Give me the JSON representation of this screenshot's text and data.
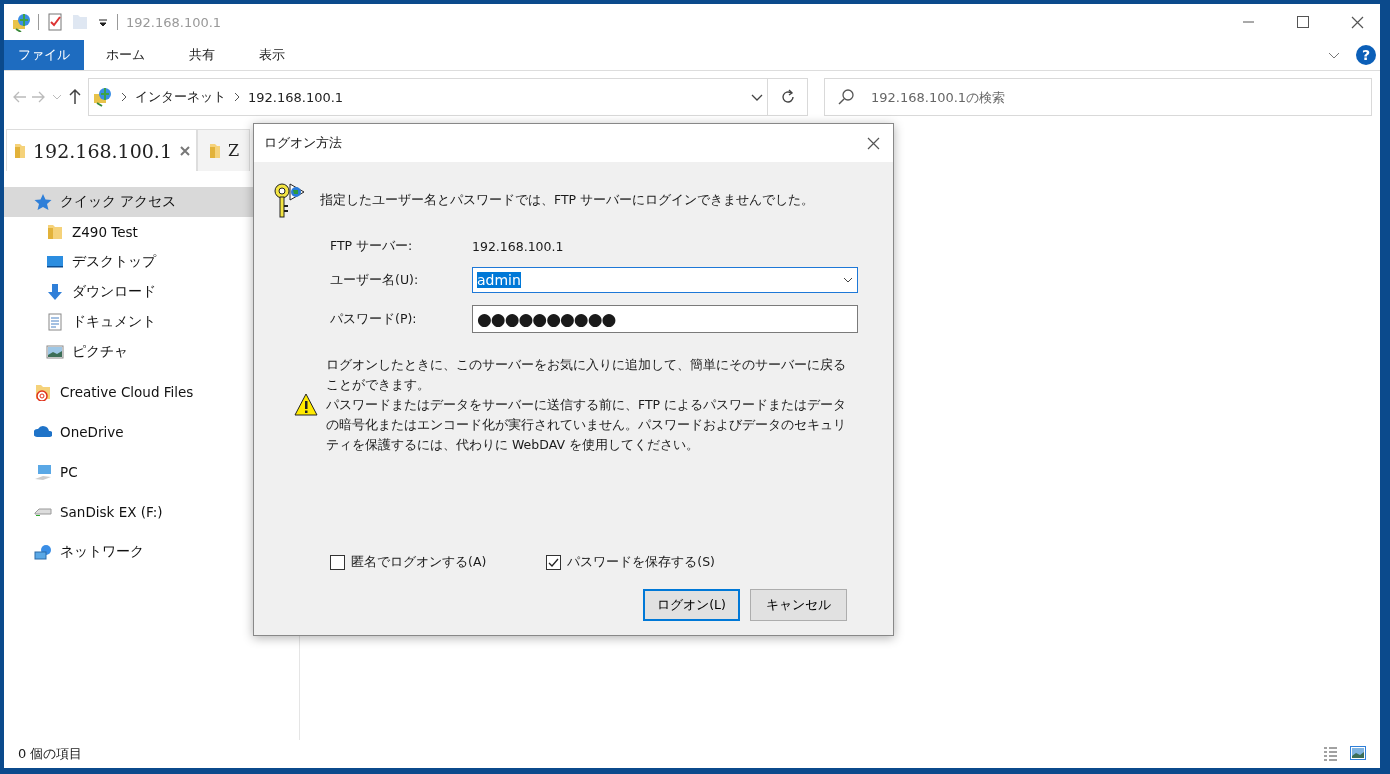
{
  "window": {
    "title": "192.168.100.1"
  },
  "help_button": "?",
  "ribbon_tabs": [
    {
      "label": "ファイル",
      "selected": true
    },
    {
      "label": "ホーム",
      "selected": false
    },
    {
      "label": "共有",
      "selected": false
    },
    {
      "label": "表示",
      "selected": false
    }
  ],
  "address_bar": {
    "breadcrumbs": [
      "インターネット",
      "192.168.100.1"
    ]
  },
  "search": {
    "placeholder": "192.168.100.1の検索"
  },
  "doc_tabs": [
    {
      "label": "192.168.100.1",
      "selected": true
    },
    {
      "label": "Z",
      "selected": false
    }
  ],
  "sidebar": {
    "items": [
      {
        "label": "クイック アクセス",
        "selected": true,
        "children": [
          {
            "label": "Z490 Test",
            "selected": false
          },
          {
            "label": "デスクトップ",
            "selected": false
          },
          {
            "label": "ダウンロード",
            "selected": false
          },
          {
            "label": "ドキュメント",
            "selected": false
          },
          {
            "label": "ピクチャ",
            "selected": false
          }
        ]
      },
      {
        "label": "Creative Cloud Files",
        "selected": false
      },
      {
        "label": "OneDrive",
        "selected": false
      },
      {
        "label": "PC",
        "selected": false
      },
      {
        "label": "SanDisk EX (F:)",
        "selected": false
      },
      {
        "label": "ネットワーク",
        "selected": false
      }
    ]
  },
  "status_bar": {
    "item_count": "0 個の項目"
  },
  "dialog": {
    "title": "ログオン方法",
    "message": "指定したユーザー名とパスワードでは、FTP サーバーにログインできませんでした。",
    "server": {
      "label": "FTP サーバー:",
      "value": "192.168.100.1"
    },
    "username": {
      "label": "ユーザー名(U):",
      "value": "admin"
    },
    "password": {
      "label": "パスワード(P):",
      "value": "●●●●●●●●●●"
    },
    "notes": [
      "ログオンしたときに、このサーバーをお気に入りに追加して、簡単にそのサーバーに戻ることができます。",
      "パスワードまたはデータをサーバーに送信する前に、FTP によるパスワードまたはデータの暗号化またはエンコード化が実行されていません。パスワードおよびデータのセキュリティを保護するには、代わりに WebDAV を使用してください。"
    ],
    "checkboxes": [
      {
        "label": "匿名でログオンする(A)",
        "checked": false
      },
      {
        "label": "パスワードを保存する(S)",
        "checked": true
      }
    ],
    "buttons": [
      {
        "label": "ログオン(L)",
        "default": true
      },
      {
        "label": "キャンセル",
        "default": false
      }
    ]
  }
}
